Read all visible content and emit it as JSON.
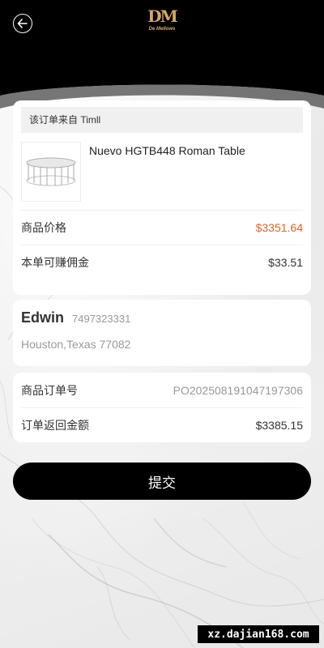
{
  "header": {
    "logo_mark": "DM",
    "logo_text": "De Mellows"
  },
  "product_card": {
    "source": "该订单来自 Timll",
    "product_name": "Nuevo HGTB448 Roman Table",
    "price_label": "商品价格",
    "price_value": "$3351.64",
    "commission_label": "本单可赚佣金",
    "commission_value": "$33.51"
  },
  "address": {
    "name": "Edwin",
    "phone": "7497323331",
    "location": "Houston,Texas 77082"
  },
  "order": {
    "order_no_label": "商品订单号",
    "order_no_value": "PO2025081910471973​06",
    "refund_label": "订单返回金额",
    "refund_value": "$3385.15"
  },
  "submit_label": "提交",
  "watermark": "xz.dajian168.com",
  "colors": {
    "header": "#000000",
    "price": "#e2642a",
    "logo_gold": "#d2a86a"
  }
}
